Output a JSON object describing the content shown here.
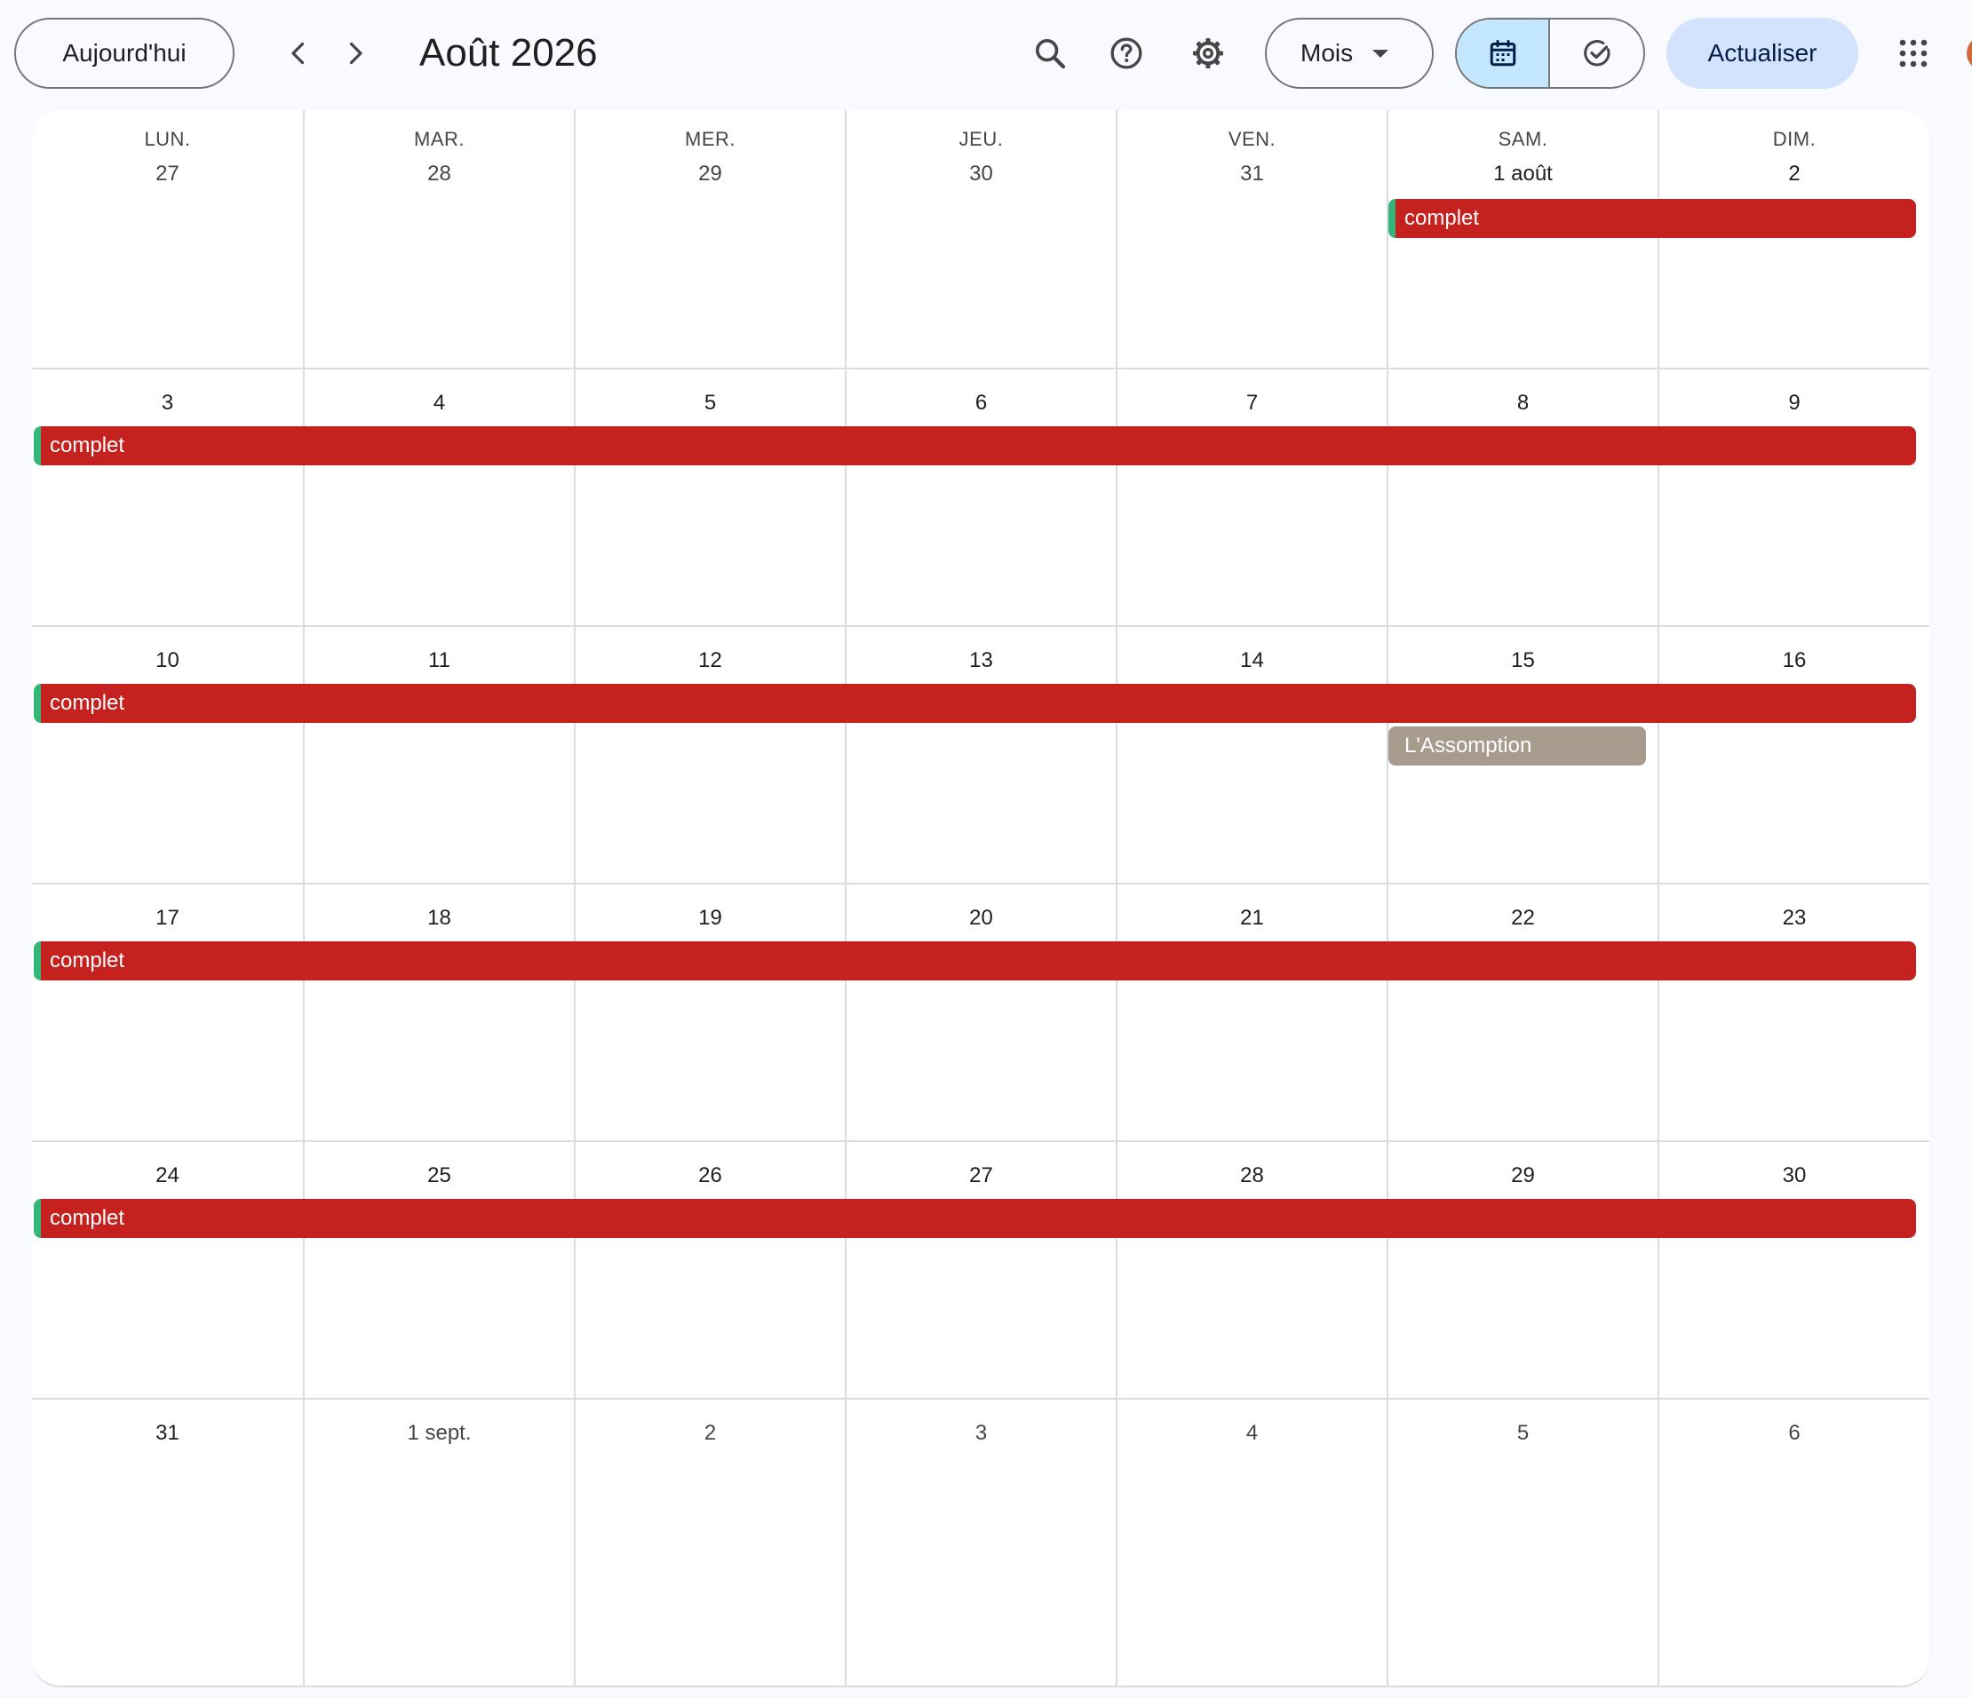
{
  "header": {
    "today_label": "Aujourd'hui",
    "month_title": "Août 2026",
    "view_label": "Mois",
    "refresh_label": "Actualiser"
  },
  "weekdays": [
    "LUN.",
    "MAR.",
    "MER.",
    "JEU.",
    "VEN.",
    "SAM.",
    "DIM."
  ],
  "weeks": [
    {
      "days": [
        "27",
        "28",
        "29",
        "30",
        "31",
        "1 août",
        "2"
      ]
    },
    {
      "days": [
        "3",
        "4",
        "5",
        "6",
        "7",
        "8",
        "9"
      ]
    },
    {
      "days": [
        "10",
        "11",
        "12",
        "13",
        "14",
        "15",
        "16"
      ]
    },
    {
      "days": [
        "17",
        "18",
        "19",
        "20",
        "21",
        "22",
        "23"
      ]
    },
    {
      "days": [
        "24",
        "25",
        "26",
        "27",
        "28",
        "29",
        "30"
      ]
    },
    {
      "days": [
        "31",
        "1 sept.",
        "2",
        "3",
        "4",
        "5",
        "6"
      ]
    }
  ],
  "events": {
    "w0": "complet",
    "w1": "complet",
    "w2": "complet",
    "w2_holiday": "L'Assomption",
    "w3": "complet",
    "w4": "complet"
  },
  "colors": {
    "event_red": "#c5221f",
    "event_stripe": "#33b679",
    "holiday_gray": "#a79b8e",
    "accent_active": "#c2e7ff",
    "refresh_bg": "#d3e3fd"
  },
  "icons": [
    "chevron-left-icon",
    "chevron-right-icon",
    "search-icon",
    "help-icon",
    "gear-icon",
    "caret-down-icon",
    "calendar-icon",
    "task-check-icon",
    "apps-grid-icon"
  ]
}
